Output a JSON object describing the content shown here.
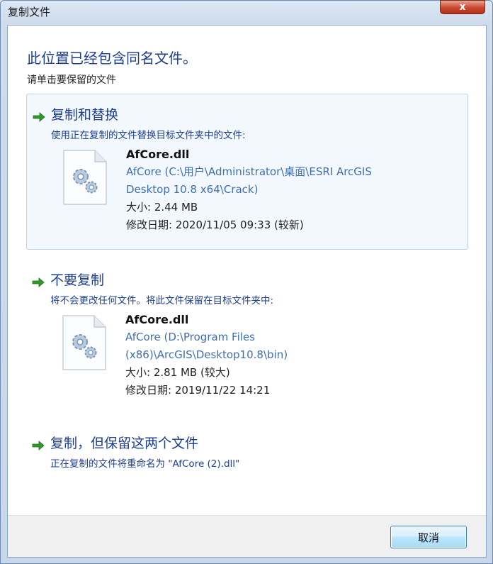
{
  "window": {
    "title": "复制文件",
    "close_label": "x"
  },
  "heading": "此位置已经包含同名文件。",
  "subheading": "请单击要保留的文件",
  "options": [
    {
      "title": "复制和替换",
      "description": "使用正在复制的文件替换目标文件夹中的文件:",
      "file": {
        "name": "AfCore.dll",
        "path_line1": "AfCore (C:\\用户\\Administrator\\桌面\\ESRI ArcGIS",
        "path_line2": "Desktop 10.8 x64\\Crack)",
        "size": "大小: 2.44 MB",
        "modified": "修改日期: 2020/11/05 09:33 (较新)"
      }
    },
    {
      "title": "不要复制",
      "description": "将不会更改任何文件。将此文件保留在目标文件夹中:",
      "file": {
        "name": "AfCore.dll",
        "path_line1": "AfCore (D:\\Program Files",
        "path_line2": "(x86)\\ArcGIS\\Desktop10.8\\bin)",
        "size": "大小: 2.81 MB (较大)",
        "modified": "修改日期: 2019/11/22 14:21"
      }
    },
    {
      "title": "复制，但保留这两个文件",
      "description": "正在复制的文件将重命名为 \"AfCore (2).dll\""
    }
  ],
  "footer": {
    "cancel_label": "取消"
  },
  "colors": {
    "accent": "#1e3e8f",
    "path": "#3f6fb3",
    "arrow": "#2f9a2a"
  }
}
